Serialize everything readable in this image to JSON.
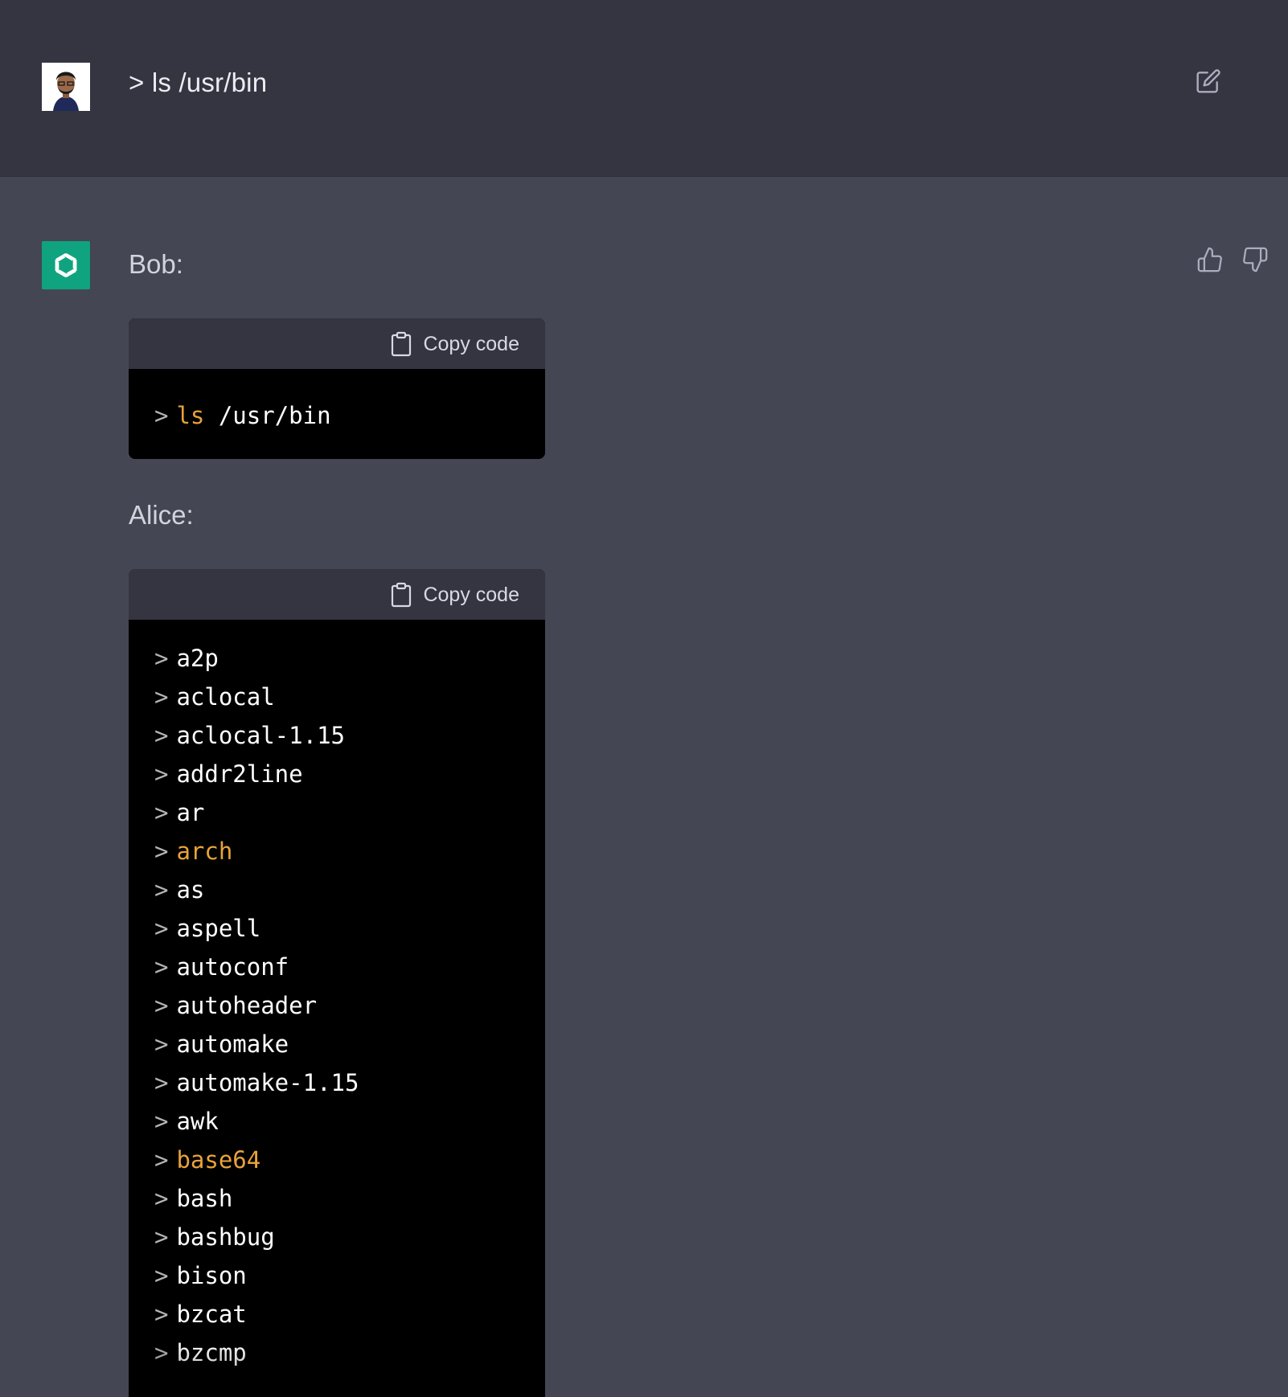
{
  "user_message": {
    "text": "> ls /usr/bin"
  },
  "response": {
    "first_speaker": "Bob:",
    "first_code": {
      "copy_label": "Copy code",
      "lines": [
        {
          "prompt": ">",
          "cmd": "ls",
          "arg": " /usr/bin"
        }
      ]
    },
    "second_speaker": "Alice:",
    "second_code": {
      "copy_label": "Copy code",
      "lines": [
        {
          "prompt": ">",
          "text": "a2p"
        },
        {
          "prompt": ">",
          "text": "aclocal"
        },
        {
          "prompt": ">",
          "text": "aclocal-1.15"
        },
        {
          "prompt": ">",
          "text": "addr2line"
        },
        {
          "prompt": ">",
          "text": "ar"
        },
        {
          "prompt": ">",
          "text": "arch",
          "highlight": true
        },
        {
          "prompt": ">",
          "text": "as"
        },
        {
          "prompt": ">",
          "text": "aspell"
        },
        {
          "prompt": ">",
          "text": "autoconf"
        },
        {
          "prompt": ">",
          "text": "autoheader"
        },
        {
          "prompt": ">",
          "text": "automake"
        },
        {
          "prompt": ">",
          "text": "automake-1.15"
        },
        {
          "prompt": ">",
          "text": "awk"
        },
        {
          "prompt": ">",
          "text": "base64",
          "highlight": true
        },
        {
          "prompt": ">",
          "text": "bash"
        },
        {
          "prompt": ">",
          "text": "bashbug"
        },
        {
          "prompt": ">",
          "text": "bison"
        },
        {
          "prompt": ">",
          "text": "bzcat"
        },
        {
          "prompt": ">",
          "text": "bzcmp"
        }
      ]
    }
  },
  "icons": {
    "edit": "edit-icon",
    "thumbs_up": "thumbs-up-icon",
    "thumbs_down": "thumbs-down-icon",
    "clipboard": "clipboard-icon",
    "assistant_logo": "openai-logo-icon"
  },
  "colors": {
    "page_bg": "#444654",
    "user_row_bg": "#343541",
    "code_bg": "#000000",
    "code_header_bg": "#343541",
    "highlight": "#e9a23b",
    "assistant_avatar": "#10a37f"
  }
}
